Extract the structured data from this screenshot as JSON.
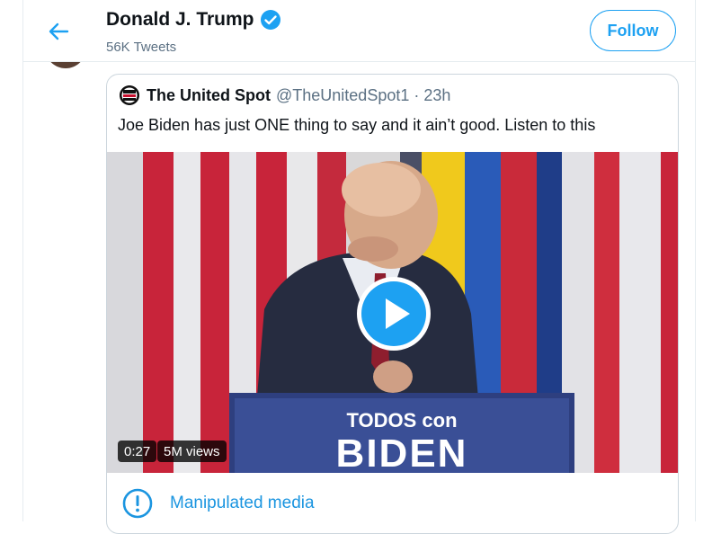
{
  "header": {
    "title": "Donald J. Trump",
    "subtitle": "56K Tweets",
    "follow_label": "Follow"
  },
  "quoted_tweet": {
    "name": "The United Spot",
    "handle": "@TheUnitedSpot1",
    "separator": "·",
    "time": "23h",
    "text": "Joe Biden has just ONE thing to say and it ain’t good. Listen to this",
    "avatar_text": [
      "THE",
      "UNITED",
      "SPOT"
    ]
  },
  "video": {
    "duration": "0:27",
    "views": "5M views",
    "podium_line1": "TODOS con",
    "podium_line2": "BIDEN"
  },
  "notice": {
    "label": "Manipulated media"
  },
  "colors": {
    "accent": "#1da1f2",
    "notice_text": "#1b95e0",
    "secondary_text": "#5b7083"
  },
  "icons": {
    "back": "arrow-left-icon",
    "verified": "verified-badge-icon",
    "play": "play-icon",
    "notice": "exclamation-circle-icon"
  }
}
